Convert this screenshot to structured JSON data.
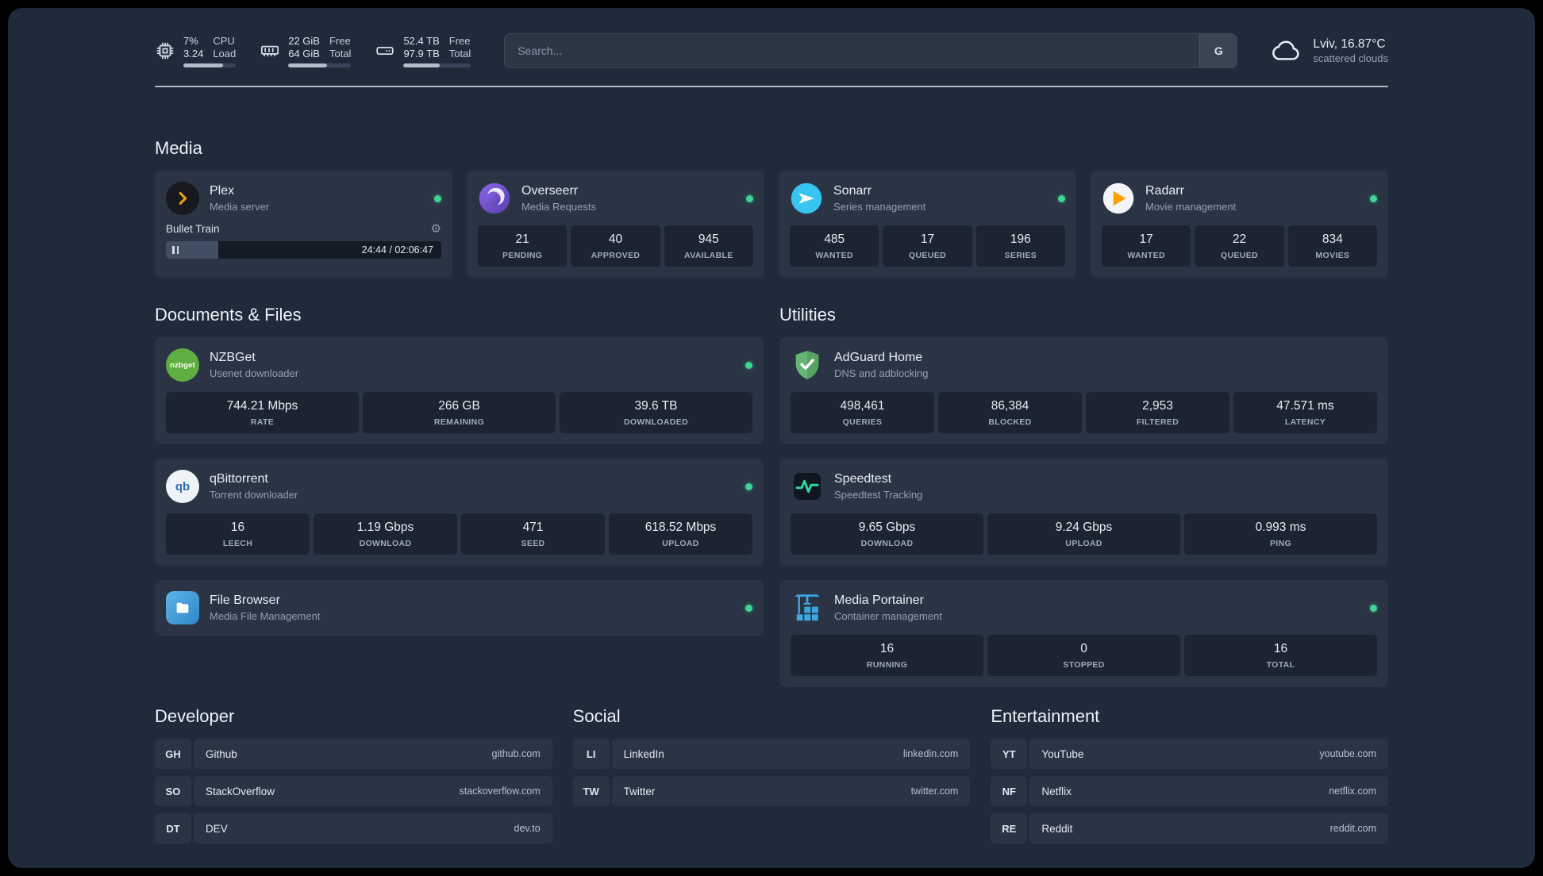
{
  "topbar": {
    "resources": [
      {
        "icon": "cpu-icon",
        "values": [
          "7%",
          "3.24"
        ],
        "labels": [
          "CPU",
          "Load"
        ],
        "bar_percent": 75
      },
      {
        "icon": "ram-icon",
        "values": [
          "22 GiB",
          "64 GiB"
        ],
        "labels": [
          "Free",
          "Total"
        ],
        "bar_percent": 62
      },
      {
        "icon": "disk-icon",
        "values": [
          "52.4 TB",
          "97.9 TB"
        ],
        "labels": [
          "Free",
          "Total"
        ],
        "bar_percent": 54
      }
    ],
    "search": {
      "placeholder": "Search...",
      "provider_label": "G"
    },
    "weather": {
      "location": "Lviv, 16.87°C",
      "condition": "scattered clouds"
    }
  },
  "media": {
    "title": "Media",
    "cards": [
      {
        "name": "Plex",
        "subtitle": "Media server",
        "status": "online",
        "player": {
          "track": "Bullet Train",
          "time": "24:44 / 02:06:47",
          "progress_percent": 19
        }
      },
      {
        "name": "Overseerr",
        "subtitle": "Media Requests",
        "status": "online",
        "stats": [
          {
            "value": "21",
            "label": "PENDING"
          },
          {
            "value": "40",
            "label": "APPROVED"
          },
          {
            "value": "945",
            "label": "AVAILABLE"
          }
        ]
      },
      {
        "name": "Sonarr",
        "subtitle": "Series management",
        "status": "online",
        "stats": [
          {
            "value": "485",
            "label": "WANTED"
          },
          {
            "value": "17",
            "label": "QUEUED"
          },
          {
            "value": "196",
            "label": "SERIES"
          }
        ]
      },
      {
        "name": "Radarr",
        "subtitle": "Movie management",
        "status": "online",
        "stats": [
          {
            "value": "17",
            "label": "WANTED"
          },
          {
            "value": "22",
            "label": "QUEUED"
          },
          {
            "value": "834",
            "label": "MOVIES"
          }
        ]
      }
    ]
  },
  "documents": {
    "title": "Documents & Files",
    "cards": [
      {
        "name": "NZBGet",
        "subtitle": "Usenet downloader",
        "status": "online",
        "icon_text": "nzbget",
        "stats": [
          {
            "value": "744.21 Mbps",
            "label": "RATE"
          },
          {
            "value": "266 GB",
            "label": "REMAINING"
          },
          {
            "value": "39.6 TB",
            "label": "DOWNLOADED"
          }
        ]
      },
      {
        "name": "qBittorrent",
        "subtitle": "Torrent downloader",
        "status": "online",
        "icon_text": "qb",
        "stats": [
          {
            "value": "16",
            "label": "LEECH"
          },
          {
            "value": "1.19 Gbps",
            "label": "DOWNLOAD"
          },
          {
            "value": "471",
            "label": "SEED"
          },
          {
            "value": "618.52 Mbps",
            "label": "UPLOAD"
          }
        ]
      },
      {
        "name": "File Browser",
        "subtitle": "Media File Management",
        "status": "online"
      }
    ]
  },
  "utilities": {
    "title": "Utilities",
    "cards": [
      {
        "name": "AdGuard Home",
        "subtitle": "DNS and adblocking",
        "stats": [
          {
            "value": "498,461",
            "label": "QUERIES"
          },
          {
            "value": "86,384",
            "label": "BLOCKED"
          },
          {
            "value": "2,953",
            "label": "FILTERED"
          },
          {
            "value": "47.571 ms",
            "label": "LATENCY"
          }
        ]
      },
      {
        "name": "Speedtest",
        "subtitle": "Speedtest Tracking",
        "stats": [
          {
            "value": "9.65 Gbps",
            "label": "DOWNLOAD"
          },
          {
            "value": "9.24 Gbps",
            "label": "UPLOAD"
          },
          {
            "value": "0.993 ms",
            "label": "PING"
          }
        ]
      },
      {
        "name": "Media Portainer",
        "subtitle": "Container management",
        "status": "online",
        "stats": [
          {
            "value": "16",
            "label": "RUNNING"
          },
          {
            "value": "0",
            "label": "STOPPED"
          },
          {
            "value": "16",
            "label": "TOTAL"
          }
        ]
      }
    ]
  },
  "bookmarks": {
    "groups": [
      {
        "title": "Developer",
        "items": [
          {
            "abbr": "GH",
            "name": "Github",
            "url": "github.com"
          },
          {
            "abbr": "SO",
            "name": "StackOverflow",
            "url": "stackoverflow.com"
          },
          {
            "abbr": "DT",
            "name": "DEV",
            "url": "dev.to"
          }
        ]
      },
      {
        "title": "Social",
        "items": [
          {
            "abbr": "LI",
            "name": "LinkedIn",
            "url": "linkedin.com"
          },
          {
            "abbr": "TW",
            "name": "Twitter",
            "url": "twitter.com"
          }
        ]
      },
      {
        "title": "Entertainment",
        "items": [
          {
            "abbr": "YT",
            "name": "YouTube",
            "url": "youtube.com"
          },
          {
            "abbr": "NF",
            "name": "Netflix",
            "url": "netflix.com"
          },
          {
            "abbr": "RE",
            "name": "Reddit",
            "url": "reddit.com"
          }
        ]
      }
    ]
  },
  "colors": {
    "status_online": "#3fd68f",
    "background": "#1f2a3a"
  }
}
